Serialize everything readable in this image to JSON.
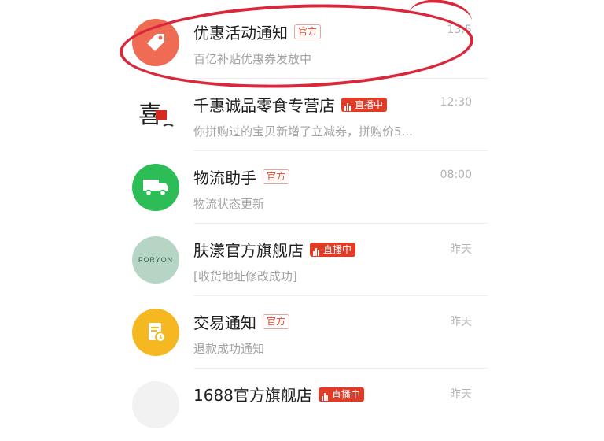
{
  "messages": [
    {
      "title": "优惠活动通知",
      "badge": "官方",
      "badge_type": "official",
      "subtitle": "百亿补贴优惠券发放中",
      "time": "13:5",
      "icon": "price-tag-icon",
      "icon_color": "#ef6b53"
    },
    {
      "title": "千惠诚品零食专营店",
      "badge": "直播中",
      "badge_type": "live",
      "subtitle": "你拼购过的宝贝新增了立减券，拼购价5...",
      "time": "12:30",
      "icon": "store-logo-icon",
      "logo_text": "喜"
    },
    {
      "title": "物流助手",
      "badge": "官方",
      "badge_type": "official",
      "subtitle": "物流状态更新",
      "time": "08:00",
      "icon": "truck-icon",
      "icon_color": "#2dbd57"
    },
    {
      "title": "肤漾官方旗舰店",
      "badge": "直播中",
      "badge_type": "live",
      "subtitle": "[收货地址修改成功]",
      "time": "昨天",
      "icon": "brand-logo-icon",
      "logo_text": "FORYON",
      "icon_color": "#b7d5c4"
    },
    {
      "title": "交易通知",
      "badge": "官方",
      "badge_type": "official",
      "subtitle": "退款成功通知",
      "time": "昨天",
      "icon": "document-icon",
      "icon_color": "#f5b820"
    },
    {
      "title": "1688官方旗舰店",
      "badge": "直播中",
      "badge_type": "live",
      "subtitle": "",
      "time": "昨天",
      "icon": "store-logo-icon"
    }
  ],
  "annotation": {
    "color": "#d9283b"
  }
}
